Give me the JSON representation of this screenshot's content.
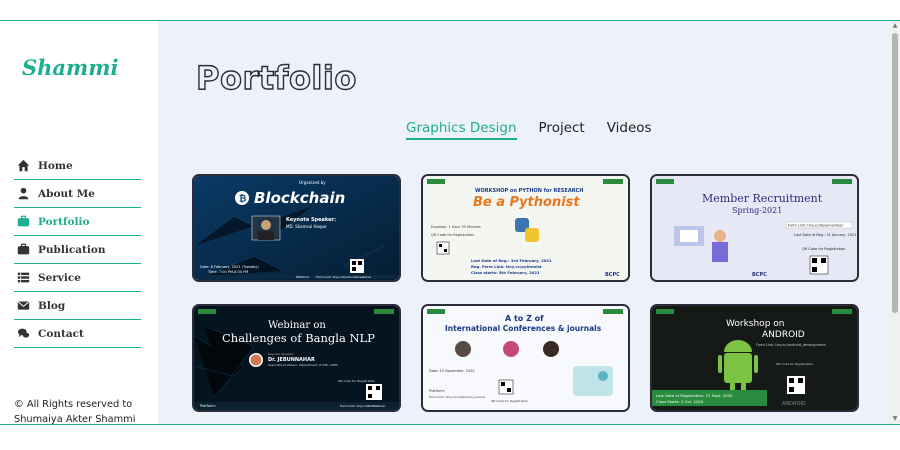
{
  "sidebar": {
    "brand": "Shammi",
    "nav": [
      {
        "label": "Home",
        "icon": "home-icon"
      },
      {
        "label": "About Me",
        "icon": "user-icon"
      },
      {
        "label": "Portfolio",
        "icon": "briefcase-icon"
      },
      {
        "label": "Publication",
        "icon": "briefcase-icon"
      },
      {
        "label": "Service",
        "icon": "list-icon"
      },
      {
        "label": "Blog",
        "icon": "envelope-icon"
      },
      {
        "label": "Contact",
        "icon": "comments-icon"
      }
    ],
    "copyright": "© All Rights reserved to Shumaiya Akter Shammi"
  },
  "main": {
    "title": "Portfolio",
    "tabs": [
      "Graphics Design",
      "Project",
      "Videos"
    ],
    "active_tab": 0
  },
  "cards": [
    {
      "heading": "Blockchain",
      "lines": [
        "Organized by",
        "Keynote Speaker:",
        "MD. Shamsul Haque",
        "Date: 8 February, 2021 (Tuesday)",
        "Time: 7:00 PM-8:30 PM",
        "Platform:",
        "Form Link: tiny.cc/blockchainwebinar"
      ]
    },
    {
      "heading": "Be a Pythonist",
      "lines": [
        "WORKSHOP on PYTHON for RESEARCH",
        "Duration: 1 Hour 30 Minutes",
        "QR Code for Registration",
        "Last Date of Reg.: 3rd February, 2021",
        "Reg. Form Link: tiny.cc/pythonist",
        "Class starts: 5th February, 2021"
      ]
    },
    {
      "heading": "Member Recruitment",
      "lines": [
        "Spring-2021",
        "Form Link: tiny.cc/devomember",
        "Last Date of Reg.: 31 January, 2021",
        "QR Code for Registration"
      ]
    },
    {
      "heading": "Challenges of Bangla NLP",
      "lines": [
        "Webinar on",
        "Keynote Speaker:",
        "Dr. JEBUNNAHAR",
        "Associate Professor, Department of CSE, CUET",
        "QR Code for Registration",
        "Platform:",
        "Form Link: tiny.cc/NLPWebinar"
      ]
    },
    {
      "heading": "International Conferences & journals",
      "lines": [
        "A to Z of",
        "Date: 19 November, 2020",
        "Platform:",
        "Form Link: tiny.cc/conference_journal",
        "QR Code for Registration"
      ]
    },
    {
      "heading": "ANDROID",
      "lines": [
        "Workshop on",
        "Form Link: tiny.cc/android_development",
        "QR Code for Registration",
        "Last Date of Registration: 27 Sept. 2020",
        "Class Starts: 2 Oct. 2020"
      ]
    }
  ],
  "colors": {
    "accent": "#1fae8d",
    "card_border": "#2b2b3a",
    "page_bg": "#edf2fa"
  }
}
